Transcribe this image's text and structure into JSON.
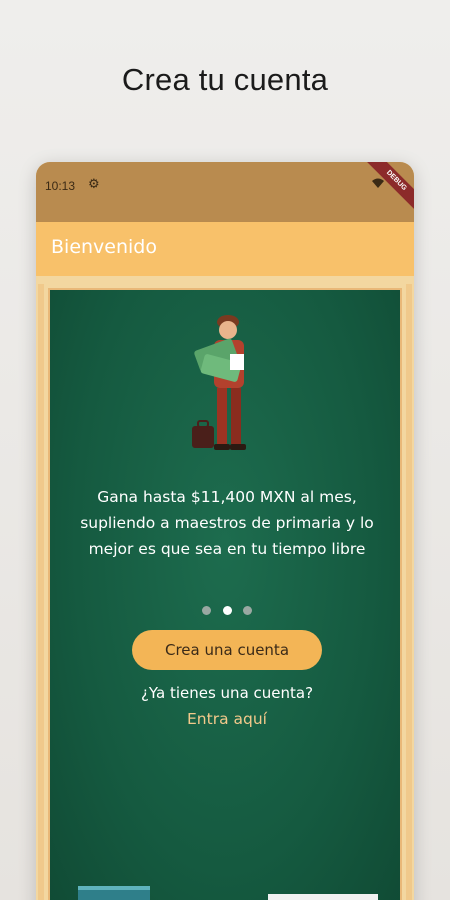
{
  "headline": "Crea tu cuenta",
  "status_bar": {
    "time": "10:13",
    "debug_label": "DEBUG"
  },
  "app_bar": {
    "title": "Bienvenido"
  },
  "onboarding": {
    "message": "Gana hasta $11,400 MXN al mes, supliendo a maestros de primaria y lo mejor es que sea en tu tiempo libre",
    "pager": {
      "total": 3,
      "active_index": 2
    },
    "create_account_label": "Crea una cuenta",
    "have_account_text": "¿Ya tienes una cuenta?",
    "login_link_label": "Entra aquí"
  },
  "colors": {
    "status_bar": "#b98b4f",
    "app_bar": "#f8c16a",
    "board": "#155a40",
    "cta": "#f3b556",
    "link": "#f3c98b"
  },
  "icons": [
    "gear-icon",
    "wifi-icon",
    "teacher-illustration"
  ]
}
